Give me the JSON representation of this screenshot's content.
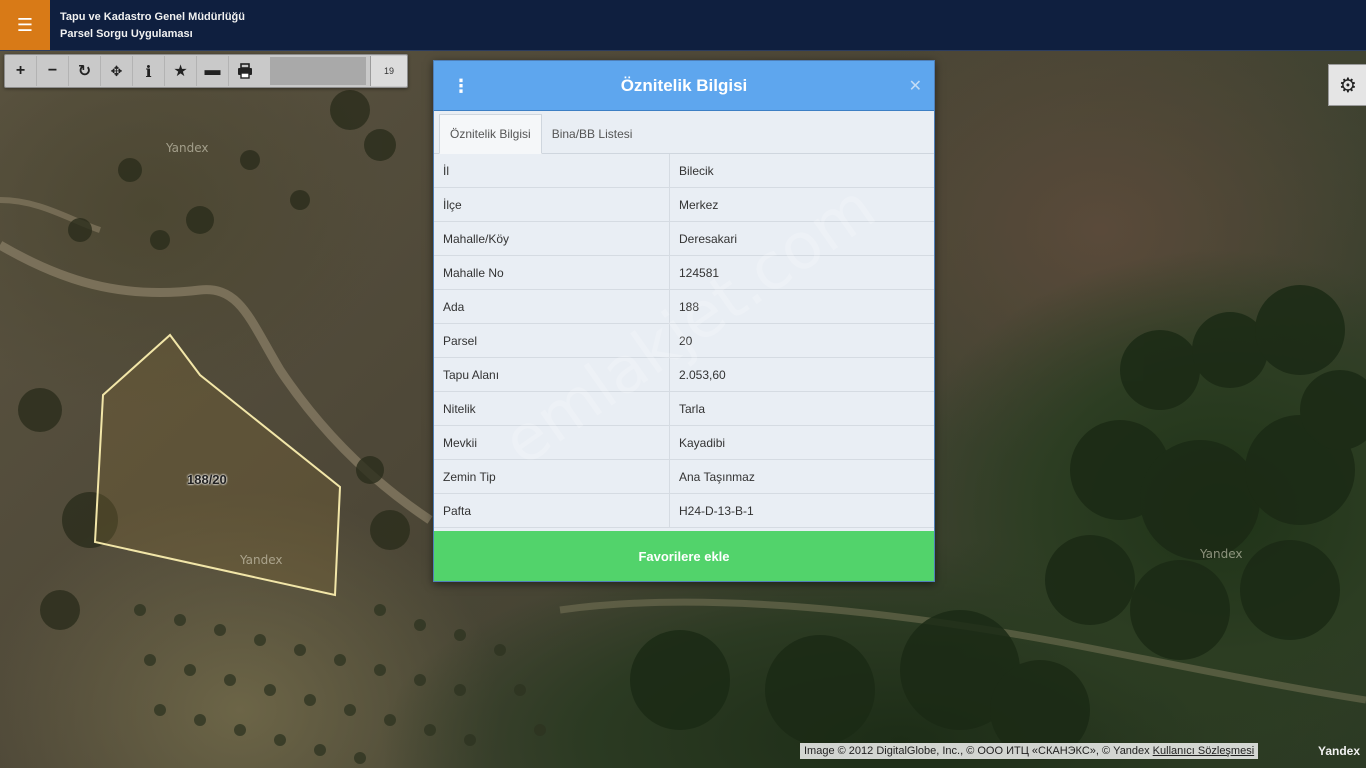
{
  "header": {
    "title_line1": "Tapu ve Kadastro Genel Müdürlüğü",
    "title_line2": "Parsel Sorgu Uygulaması",
    "menu_icon": "hamburger-icon"
  },
  "toolbar": {
    "buttons": [
      "zoom-in-icon",
      "zoom-out-icon",
      "refresh-icon",
      "pan-icon",
      "info-icon",
      "star-icon",
      "measure-icon",
      "print-icon"
    ],
    "zoom_level": "19"
  },
  "map": {
    "parcel_label": "188/20",
    "tile_marks": [
      "Yandex",
      "Yandex",
      "Yandex"
    ]
  },
  "dialog": {
    "title": "Öznitelik Bilgisi",
    "tabs": [
      "Öznitelik Bilgisi",
      "Bina/BB Listesi"
    ],
    "rows": [
      {
        "key": "İl",
        "value": "Bilecik"
      },
      {
        "key": "İlçe",
        "value": "Merkez"
      },
      {
        "key": "Mahalle/Köy",
        "value": "Deresakari"
      },
      {
        "key": "Mahalle No",
        "value": "124581"
      },
      {
        "key": "Ada",
        "value": "188"
      },
      {
        "key": "Parsel",
        "value": "20"
      },
      {
        "key": "Tapu Alanı",
        "value": "2.053,60"
      },
      {
        "key": "Nitelik",
        "value": "Tarla"
      },
      {
        "key": "Mevkii",
        "value": "Kayadibi"
      },
      {
        "key": "Zemin Tip",
        "value": "Ana Taşınmaz"
      },
      {
        "key": "Pafta",
        "value": "H24-D-13-B-1"
      }
    ],
    "favorite_button": "Favorilere ekle"
  },
  "watermark": "emlakjet.com",
  "attribution": {
    "text": "Image © 2012 DigitalGlobe, Inc., © ООО ИТЦ «СКАНЭКС», © Yandex",
    "link": "Kullanıcı Sözleşmesi",
    "logo": "Yandex"
  },
  "colors": {
    "header_bg": "#0f1f3f",
    "menu_button": "#d87a17",
    "dialog_header": "#5ea6ee",
    "favorite_button": "#52d36b",
    "parcel_outline": "#f2e6a8"
  }
}
